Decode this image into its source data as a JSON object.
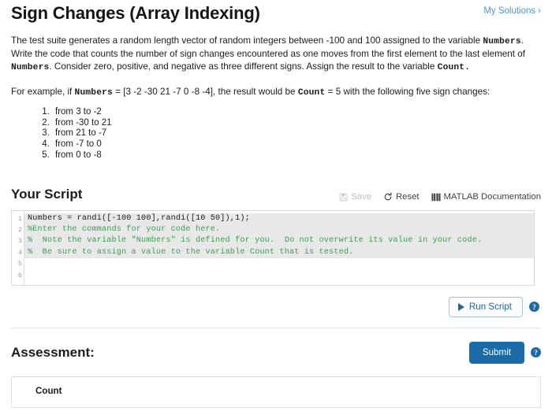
{
  "header": {
    "title": "Sign Changes (Array Indexing)",
    "my_solutions_label": "My Solutions",
    "my_solutions_chevron": "›",
    "link_color": "#4a9cc4"
  },
  "description": {
    "paragraph1_part1": "The test suite generates a random length vector of random integers between -100 and 100 assigned to the variable ",
    "paragraph1_var1": "Numbers",
    "paragraph1_part2": ". Write the code that counts the number of sign changes encountered as one moves from the first element to the last element of ",
    "paragraph1_var2": "Numbers",
    "paragraph1_part3": ". Consider zero, positive, and negative as three different signs. Assign the result to the variable ",
    "paragraph1_var3": "Count.",
    "paragraph2_part1": "For example, if ",
    "paragraph2_var1": "Numbers",
    "paragraph2_part2": " = [3 -2 -30 21 -7 0 -8 -4], the result would be ",
    "paragraph2_var2": "Count",
    "paragraph2_part3": " = 5 with the following five sign changes:",
    "sign_changes": [
      "from 3 to -2",
      "from -30 to 21",
      "from 21 to -7",
      "from -7 to 0",
      "from 0 to -8"
    ]
  },
  "script_section": {
    "title": "Your Script",
    "toolbar": {
      "save_label": "Save",
      "save_icon": "floppy-disk-icon",
      "save_disabled": true,
      "reset_label": "Reset",
      "reset_icon": "refresh-icon",
      "doc_label": "MATLAB Documentation",
      "doc_icon": "book-icon"
    },
    "editor": {
      "line_numbers": [
        "1",
        "2",
        "3",
        "4",
        "5",
        "6"
      ],
      "lines": [
        {
          "text": "Numbers = randi([-100 100],randi([10 50]),1);",
          "kind": "statement",
          "locked": true
        },
        {
          "text": "%Enter the commands for your code here.",
          "kind": "comment",
          "locked": true
        },
        {
          "text": "%  Note the variable \"Numbers\" is defined for you.  Do not overwrite its value in your code.",
          "kind": "comment",
          "locked": true
        },
        {
          "text": "%  Be sure to assign a value to the variable Count that is tested.",
          "kind": "comment",
          "locked": true
        },
        {
          "text": "",
          "kind": "empty",
          "locked": false
        },
        {
          "text": "",
          "kind": "empty",
          "locked": false
        }
      ],
      "comment_color": "#3f9b52",
      "locked_bg": "#e8e8e8"
    },
    "run_button_label": "Run Script",
    "run_button_icon": "play-icon",
    "help_icon_label": "?"
  },
  "assessment_section": {
    "title": "Assessment:",
    "submit_label": "Submit",
    "help_icon_label": "?",
    "submit_color": "#1a6ba8",
    "rows": [
      {
        "label": "Count"
      }
    ]
  }
}
